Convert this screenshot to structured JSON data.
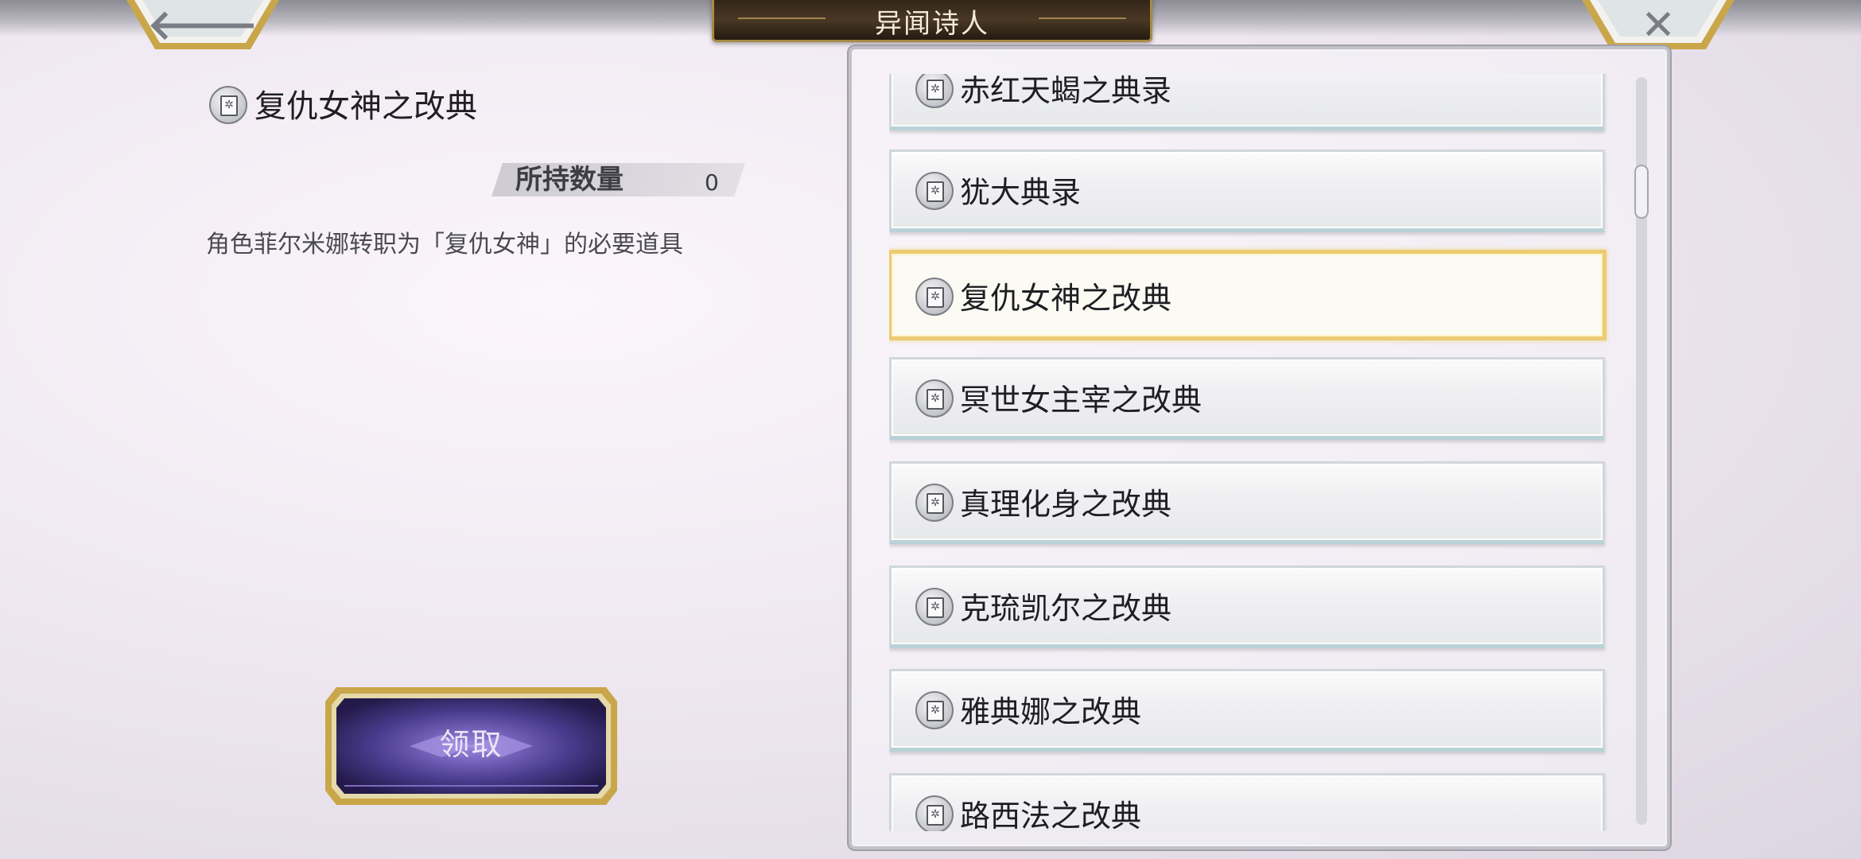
{
  "header": {
    "title": "异闻诗人",
    "back_icon": "arrow-left-icon",
    "close_icon": "close-icon"
  },
  "detail": {
    "name": "复仇女神之改典",
    "quantity_label": "所持数量",
    "quantity_value": "0",
    "description": "角色菲尔米娜转职为「复仇女神」的必要道具"
  },
  "actions": {
    "receive_label": "领取"
  },
  "list": {
    "items": [
      {
        "label": "赤红天蝎之典录"
      },
      {
        "label": "犹大典录"
      },
      {
        "label": "复仇女神之改典"
      },
      {
        "label": "冥世女主宰之改典"
      },
      {
        "label": "真理化身之改典"
      },
      {
        "label": "克琉凯尔之改典"
      },
      {
        "label": "雅典娜之改典"
      },
      {
        "label": "路西法之改典"
      }
    ],
    "selected_index": 2
  },
  "colors": {
    "accent_gold": "#eccb72",
    "button_purple": "#5b4aa3",
    "title_plate": "#3a2a1a"
  }
}
